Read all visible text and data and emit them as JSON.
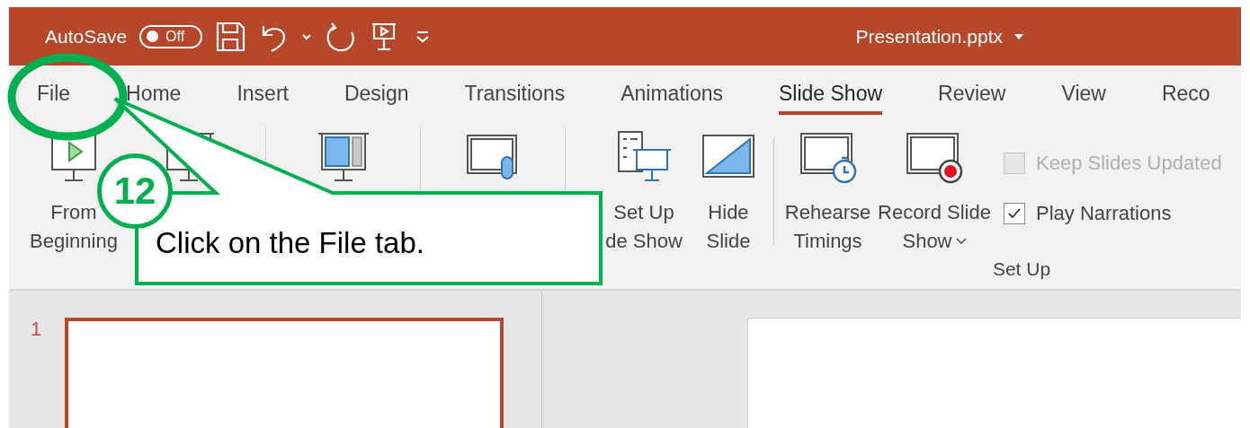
{
  "title_bar": {
    "autosave_label": "AutoSave",
    "autosave_toggle": {
      "label": "Off",
      "on": false
    },
    "document_title": "Presentation.pptx"
  },
  "tabs": [
    {
      "label": "File",
      "selected": false
    },
    {
      "label": "Home",
      "selected": false
    },
    {
      "label": "Insert",
      "selected": false
    },
    {
      "label": "Design",
      "selected": false
    },
    {
      "label": "Transitions",
      "selected": false
    },
    {
      "label": "Animations",
      "selected": false
    },
    {
      "label": "Slide Show",
      "selected": true
    },
    {
      "label": "Review",
      "selected": false
    },
    {
      "label": "View",
      "selected": false
    },
    {
      "label": "Reco",
      "selected": false
    }
  ],
  "ribbon": {
    "groups": [
      {
        "buttons": [
          {
            "kind": "large_button",
            "label_lines": [
              "From",
              "Beginning"
            ]
          },
          {
            "kind": "large_button"
          }
        ]
      },
      {
        "buttons": [
          {
            "kind": "large_button"
          }
        ]
      },
      {
        "buttons": [
          {
            "kind": "large_button"
          }
        ]
      },
      {
        "label": "Set Up",
        "buttons": [
          {
            "kind": "large_button",
            "label_lines": [
              "Set Up",
              "de Show"
            ]
          },
          {
            "kind": "large_button",
            "label_lines": [
              "Hide",
              "Slide"
            ]
          },
          {
            "kind": "separator"
          },
          {
            "kind": "large_button",
            "label_lines": [
              "Rehearse",
              "Timings"
            ]
          },
          {
            "kind": "large_button",
            "label_lines": [
              "Record Slide",
              "Show"
            ],
            "has_menu": true
          },
          {
            "kind": "checkbox_stack",
            "items": [
              {
                "label": "Keep Slides Updated",
                "checked": false,
                "disabled": true
              },
              {
                "label": "Play Narrations",
                "checked": true,
                "disabled": false
              }
            ]
          }
        ]
      }
    ]
  },
  "thumbnails": [
    {
      "number": "1",
      "selected": true
    }
  ],
  "callout": {
    "step": "12",
    "text": "Click on the File tab."
  }
}
